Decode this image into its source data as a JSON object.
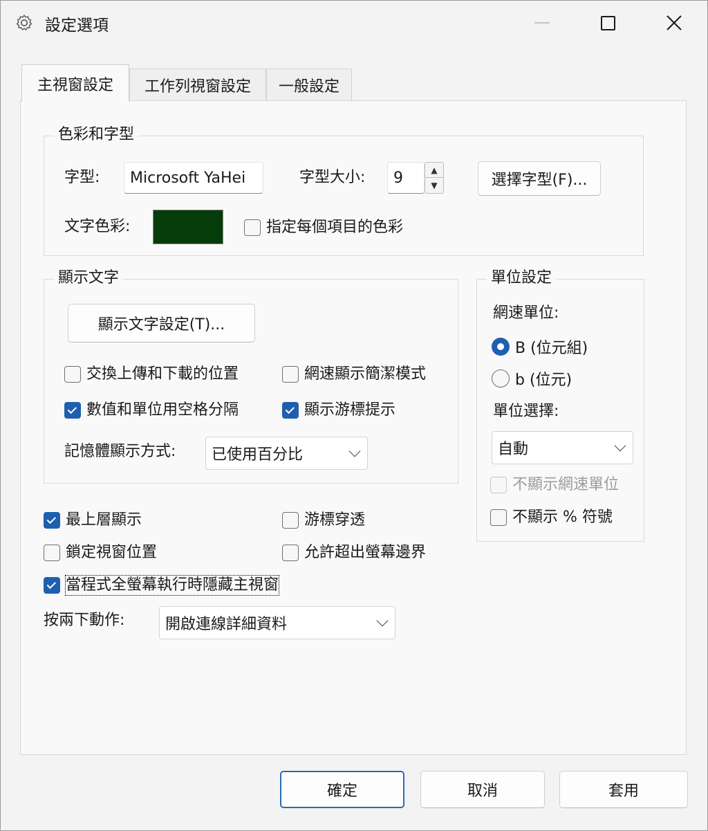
{
  "window": {
    "title": "設定選項",
    "icon": "gear-icon"
  },
  "tabs": [
    {
      "label": "主視窗設定",
      "active": true
    },
    {
      "label": "工作列視窗設定",
      "active": false
    },
    {
      "label": "一般設定",
      "active": false
    }
  ],
  "color_font_group": {
    "title": "色彩和字型",
    "font_label": "字型:",
    "font_value": "Microsoft YaHei",
    "size_label": "字型大小:",
    "size_value": "9",
    "choose_font_button": "選擇字型(F)...",
    "text_color_label": "文字色彩:",
    "text_color": "#063b0a",
    "per_item_color_checkbox": {
      "label": "指定每個項目的色彩",
      "checked": false
    }
  },
  "display_text_group": {
    "title": "顯示文字",
    "settings_button": "顯示文字設定(T)...",
    "swap_updown": {
      "label": "交換上傳和下載的位置",
      "checked": false
    },
    "compact_mode": {
      "label": "網速顯示簡潔模式",
      "checked": false
    },
    "space_separator": {
      "label": "數值和單位用空格分隔",
      "checked": true
    },
    "show_tooltip": {
      "label": "顯示游標提示",
      "checked": true
    },
    "memory_display_label": "記憶體顯示方式:",
    "memory_display_value": "已使用百分比"
  },
  "unit_group": {
    "title": "單位設定",
    "speed_unit_label": "網速單位:",
    "radio_bytes": {
      "label": "B (位元組)",
      "selected": true
    },
    "radio_bits": {
      "label": "b (位元)",
      "selected": false
    },
    "unit_select_label": "單位選擇:",
    "unit_select_value": "自動",
    "hide_speed_unit": {
      "label": "不顯示網速單位",
      "checked": false,
      "disabled": true
    },
    "hide_percent": {
      "label": "不顯示 % 符號",
      "checked": false
    }
  },
  "misc": {
    "always_on_top": {
      "label": "最上層顯示",
      "checked": true
    },
    "mouse_passthrough": {
      "label": "游標穿透",
      "checked": false
    },
    "lock_position": {
      "label": "鎖定視窗位置",
      "checked": false
    },
    "allow_offscreen": {
      "label": "允許超出螢幕邊界",
      "checked": false
    },
    "hide_fullscreen": {
      "label": "當程式全螢幕執行時隱藏主視窗",
      "checked": true
    },
    "double_click_label": "按兩下動作:",
    "double_click_value": "開啟連線詳細資料"
  },
  "footer": {
    "ok": "確定",
    "cancel": "取消",
    "apply": "套用"
  },
  "colors": {
    "accent": "#1f5fb0",
    "window_bg": "#f3f3f3",
    "panel_bg": "#f9f9f9"
  }
}
